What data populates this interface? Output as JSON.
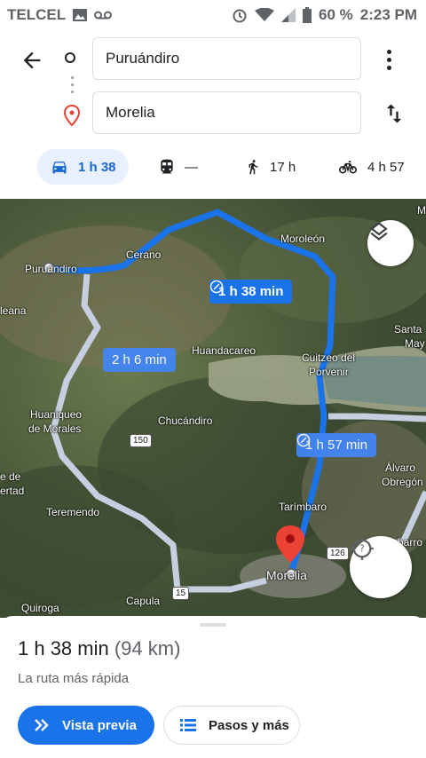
{
  "status": {
    "carrier": "TELCEL",
    "battery": "60 %",
    "time": "2:23 PM"
  },
  "search": {
    "origin": "Puruándiro",
    "destination": "Morelia"
  },
  "modes": [
    {
      "icon": "car-icon",
      "label": "1 h 38"
    },
    {
      "icon": "train-icon",
      "label": "—"
    },
    {
      "icon": "walk-icon",
      "label": "17 h"
    },
    {
      "icon": "bike-icon",
      "label": "4 h 57"
    }
  ],
  "map": {
    "places": [
      "Puruándiro",
      "Cerano",
      "Moroleón",
      "leana",
      "Huandacareo",
      "Cuitzeo del",
      "Porvenir",
      "Santa",
      "May",
      "Huaniqueo",
      "de Morales",
      "Chucándiro",
      "e de",
      "ertad",
      "Álvaro",
      "Obregón",
      "Tarímbaro",
      "Teremendo",
      "Morelia",
      "Quiroga",
      "Capula",
      "barro",
      "M"
    ],
    "highways": [
      "150",
      "126",
      "15"
    ],
    "routes": [
      "1 h 38 min",
      "2 h 6 min",
      "1 h 57 min"
    ]
  },
  "sheet": {
    "duration": "1 h 38 min",
    "distance": "(94 km)",
    "subtitle": "La ruta más rápida",
    "preview_label": "Vista previa",
    "steps_label": "Pasos y más"
  }
}
